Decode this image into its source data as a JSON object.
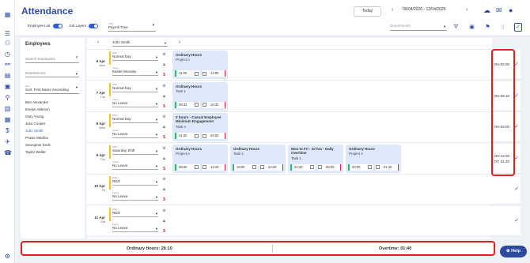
{
  "app": {
    "title": "Attendance"
  },
  "header": {
    "today_label": "Today",
    "date_from": "06/04/2026",
    "date_sep": "-",
    "date_to": "12/04/2026"
  },
  "toolbar": {
    "employee_list": "Employee List",
    "job_layers": "Job Layers",
    "view_label": "View",
    "view_value": "Payroll Time",
    "departments_placeholder": "Departments"
  },
  "employees": {
    "title": "Employees",
    "search_placeholder": "Search Employees",
    "departments": "Departments",
    "sort_label": "Sort",
    "sort_value": "Sort: First Name Ascending",
    "list": [
      "Ben Alexander",
      "Evelyn Ableson",
      "Gary Young",
      "Jess Cooper",
      "John Smith",
      "Prasie Meafou",
      "Seungmin Seok",
      "Taylor Weller"
    ],
    "selected": "John Smith"
  },
  "grid": {
    "employee_select": "John Smith"
  },
  "days": [
    {
      "date": "6 Apr",
      "dow": "Mon",
      "shift_label": "Shift *",
      "shift": "Normal Day",
      "leave_label": "Leave",
      "leave": "Easter Monday",
      "cards": [
        {
          "title": "Ordinary Hours",
          "sub": "Project A",
          "start": "11:00",
          "end": "13:00"
        }
      ],
      "total": "OH:02:00",
      "total2": ""
    },
    {
      "date": "7 Apr",
      "dow": "Tue",
      "shift_label": "Shift *",
      "shift": "Normal Day",
      "leave_label": "Leave",
      "leave": "No Leave",
      "cards": [
        {
          "title": "Ordinary Hours",
          "sub": "Task 1",
          "start": "08:33",
          "end": "16:43"
        }
      ],
      "total": "OH:08:10",
      "total2": ""
    },
    {
      "date": "8 Apr",
      "dow": "Wed",
      "shift_label": "Shift *",
      "shift": "Normal Day",
      "leave_label": "Leave",
      "leave": "No Leave",
      "cards": [
        {
          "title": "2 hours - Casual Employee Minimum Engagement",
          "sub": "Task A",
          "start": "01:00",
          "end": "03:00"
        }
      ],
      "total": "OH:02:00",
      "total2": ""
    },
    {
      "date": "9 Apr",
      "dow": "Thu",
      "shift_label": "Shift *",
      "shift": "Saturday Shift",
      "leave_label": "Leave",
      "leave": "No Leave",
      "cards": [
        {
          "title": "Ordinary Hours",
          "sub": "Project A",
          "start": "08:00",
          "end": "13:40"
        },
        {
          "title": "Ordinary Hours",
          "sub": "Task 1",
          "start": "18:00",
          "end": "22:20"
        },
        {
          "title": "Mon to Fri - 10 hrs - Daily Overtime",
          "sub": "Task 1",
          "start": "22:20",
          "end": "00:00"
        },
        {
          "title": "Ordinary Hours",
          "sub": "Project A",
          "start": "00:00",
          "end": "01:40"
        }
      ],
      "total": "OH:14:00",
      "total2": "OT: 01:40"
    },
    {
      "date": "10 Apr",
      "dow": "Fri",
      "shift_label": "Shift *",
      "shift": "RDO",
      "leave_label": "Leave",
      "leave": "No Leave",
      "cards": [],
      "total": "",
      "total2": ""
    },
    {
      "date": "11 Apr",
      "dow": "Sat",
      "shift_label": "Shift *",
      "shift": "RDO",
      "leave_label": "Leave",
      "leave": "No Leave",
      "cards": [],
      "total": "",
      "total2": ""
    }
  ],
  "footer": {
    "ordinary": "Ordinary Hours: 26:10",
    "overtime": "Overtime: 01:40"
  },
  "help": {
    "label": "Help"
  },
  "colors": {
    "accent": "#2e4a9e",
    "card": "#dde8fb",
    "shift_bar": "#f2c230",
    "highlight": "#e02020"
  }
}
